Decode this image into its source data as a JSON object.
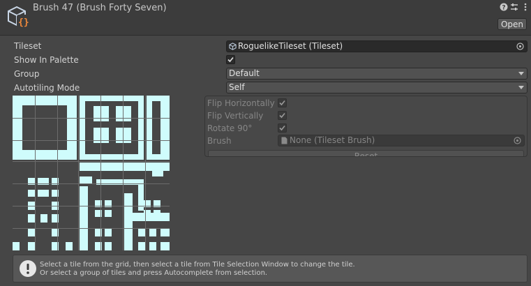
{
  "header": {
    "title": "Brush 47 (Brush Forty Seven)",
    "open_label": "Open",
    "icons": [
      "tile-brush-asset-icon",
      "help-icon",
      "preset-icon",
      "more-options-icon"
    ]
  },
  "properties": {
    "tileset": {
      "label": "Tileset",
      "value": "RoguelikeTileset (Tileset)"
    },
    "show_in_palette": {
      "label": "Show In Palette",
      "checked": true
    },
    "group": {
      "label": "Group",
      "value": "Default"
    },
    "autotiling_mode": {
      "label": "Autotiling Mode",
      "value": "Self"
    }
  },
  "tile_settings": {
    "enabled": false,
    "flip_horizontally": {
      "label": "Flip Horizontally",
      "checked": true
    },
    "flip_vertically": {
      "label": "Flip Vertically",
      "checked": true
    },
    "rotate_90": {
      "label": "Rotate 90°",
      "checked": true
    },
    "brush": {
      "label": "Brush",
      "value": "None (Tileset Brush)"
    },
    "reset_label": "Reset"
  },
  "help": {
    "line1": "Select  a tile from the grid, then select a tile from Tile Selection Window to change the tile.",
    "line2": "Or select a group of tiles and press Autocomplete from selection."
  },
  "colors": {
    "background": "#464646",
    "header": "#3c3c3c",
    "tile_fill": "#cffcfc",
    "tile_grid_line": "#6c6c6c",
    "text": "#d2d2d2",
    "disabled_text": "#868686"
  }
}
